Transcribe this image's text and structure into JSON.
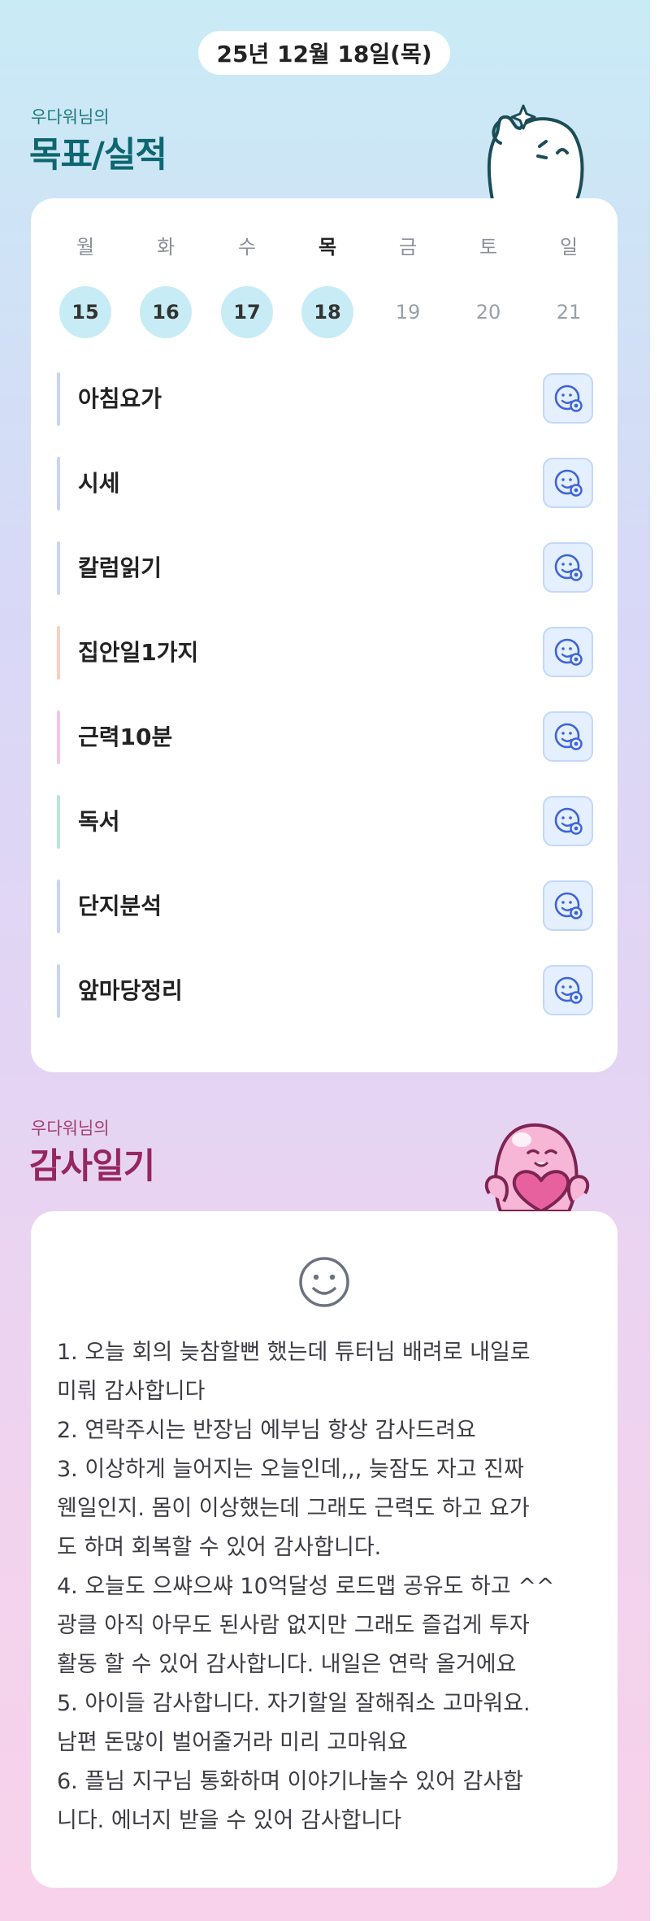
{
  "header": {
    "date": "25년 12월 18일(목)"
  },
  "goals_section": {
    "subtitle": "우다워님의",
    "title": "목표/실적",
    "week": [
      {
        "name": "월",
        "num": "15",
        "status": "done"
      },
      {
        "name": "화",
        "num": "16",
        "status": "done"
      },
      {
        "name": "수",
        "num": "17",
        "status": "done"
      },
      {
        "name": "목",
        "num": "18",
        "status": "today"
      },
      {
        "name": "금",
        "num": "19",
        "status": "future"
      },
      {
        "name": "토",
        "num": "20",
        "status": "future"
      },
      {
        "name": "일",
        "num": "21",
        "status": "future"
      }
    ],
    "goals": [
      {
        "label": "아침요가",
        "color": "#c9d4f5"
      },
      {
        "label": "시세",
        "color": "#c9d4f5"
      },
      {
        "label": "칼럼읽기",
        "color": "#c9d4f5"
      },
      {
        "label": "집안일1가지",
        "color": "#f8cfc0"
      },
      {
        "label": "근력10분",
        "color": "#f6c5e6"
      },
      {
        "label": "독서",
        "color": "#b9e7d6"
      },
      {
        "label": "단지분석",
        "color": "#c9d4f5"
      },
      {
        "label": "앞마당정리",
        "color": "#c9d4f5"
      }
    ],
    "goal_button_icon": "smiley-add-icon"
  },
  "diary_section": {
    "subtitle": "우다워님의",
    "title": "감사일기",
    "mood_icon": "smiley-face-icon",
    "lines": [
      "1. 오늘 회의 늦참할뻔 했는데 튜터님 배려로 내일로",
      "미뤄 감사합니다",
      "2. 연락주시는 반장님 에부님 항상 감사드려요",
      "3. 이상하게 늘어지는 오늘인데,,, 늦잠도 자고  진짜",
      "웬일인지. 몸이 이상했는데 그래도 근력도 하고 요가",
      "도 하며 회복할 수 있어 감사합니다.",
      "4. 오늘도 으쌰으쌰 10억달성 로드맵 공유도 하고 ^^",
      "광클 아직 아무도 된사람 없지만 그래도 즐겁게 투자",
      "활동 할 수 있어 감사합니다. 내일은 연락 올거에요",
      "5. 아이들 감사합니다. 자기할일 잘해줘소 고마워요.",
      "남편 돈많이 벌어줄거라 미리 고마워요",
      "6. 플님 지구님 통화하며 이야기나눌수 있어 감사합",
      "니다. 에너지 받을 수 있어 감사합니다"
    ]
  },
  "colors": {
    "goal_title": "#0d6670",
    "diary_title": "#96265f",
    "done_day": "#c7ecf6",
    "goal_button_bg": "#e4efff",
    "goal_button_icon": "#3f63d6"
  }
}
